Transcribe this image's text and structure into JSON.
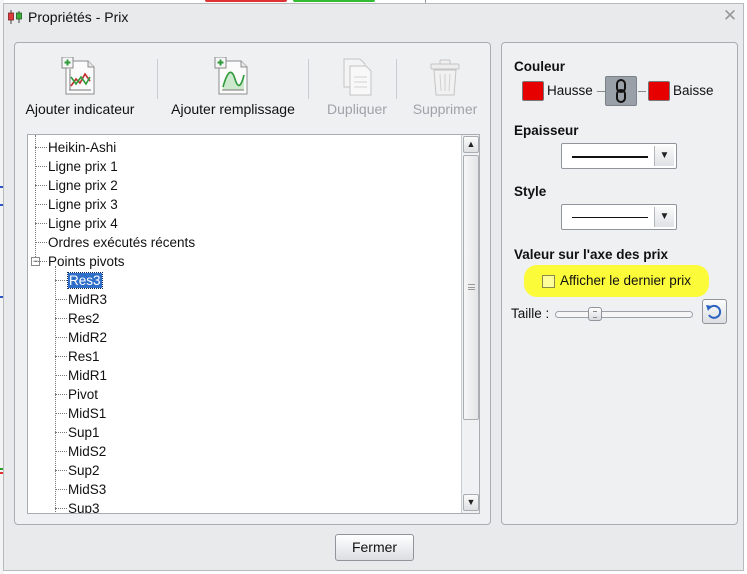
{
  "window": {
    "title": "Propriétés - Prix",
    "close_glyph": "✕",
    "icons": {
      "app": "candlestick-chart-icon",
      "close": "close-icon"
    }
  },
  "toolbar": {
    "items": [
      {
        "label": "Ajouter indicateur",
        "icon": "add-indicator-icon",
        "enabled": true
      },
      {
        "label": "Ajouter remplissage",
        "icon": "add-fill-icon",
        "enabled": true
      },
      {
        "label": "Dupliquer",
        "icon": "duplicate-icon",
        "enabled": false
      },
      {
        "label": "Supprimer",
        "icon": "trash-icon",
        "enabled": false
      }
    ]
  },
  "tree": {
    "root_items": [
      "Heikin-Ashi",
      "Ligne prix 1",
      "Ligne prix 2",
      "Ligne prix 3",
      "Ligne prix 4",
      "Ordres exécutés récents",
      "Points pivots"
    ],
    "expanded_item": "Points pivots",
    "expander_glyph": "−",
    "children": [
      "Res3",
      "MidR3",
      "Res2",
      "MidR2",
      "Res1",
      "MidR1",
      "Pivot",
      "MidS1",
      "Sup1",
      "MidS2",
      "Sup2",
      "MidS3",
      "Sup3"
    ],
    "selected_item": "Res3",
    "scroll_up_glyph": "▲",
    "scroll_down_glyph": "▼"
  },
  "properties": {
    "color": {
      "label": "Couleur",
      "up_label": "Hausse",
      "down_label": "Baisse",
      "up_color": "#e60000",
      "down_color": "#e60000",
      "link_icon": "chain-link-icon"
    },
    "thickness": {
      "label": "Epaisseur",
      "dropdown_glyph": "▼"
    },
    "style": {
      "label": "Style",
      "dropdown_glyph": "▼"
    },
    "price_axis": {
      "label": "Valeur sur l'axe des prix",
      "show_last_price_label": "Afficher le dernier prix",
      "show_last_price_checked": false,
      "highlight_color": "#fbfb3a"
    },
    "size": {
      "label": "Taille :",
      "reset_icon": "reset-icon"
    }
  },
  "footer": {
    "close_button_label": "Fermer"
  }
}
